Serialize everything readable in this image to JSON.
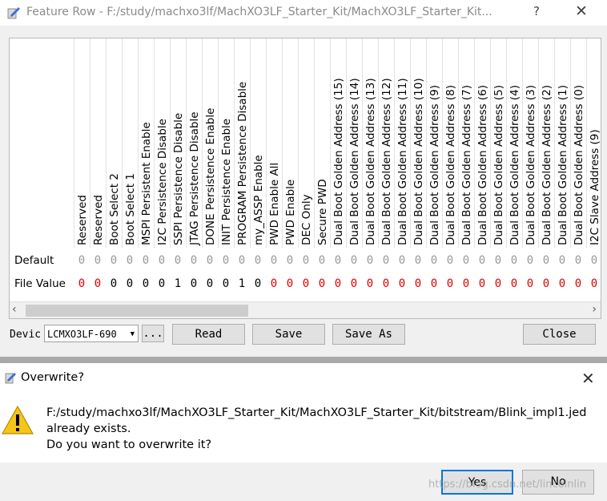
{
  "main_window": {
    "title": "Feature Row - F:/study/machxo3lf/MachXO3LF_Starter_Kit/MachXO3LF_Starter_Kit...",
    "help": "?",
    "close": "✕"
  },
  "grid": {
    "columns": [
      "Reserved",
      "Reserved",
      "Boot Select 2",
      "Boot Select 1",
      "MSPI Persistent Enable",
      "I2C Persistence Disable",
      "SSPI Persistence Disable",
      "JTAG Persistence Disable",
      "DONE Persistence Enable",
      "INIT Persistence Enable",
      "PROGRAM Persistence Disable",
      "my_ASSP Enable",
      "PWD Enable All",
      "PWD Enable",
      "DEC Only",
      "Secure PWD",
      "Dual Boot Golden Address (15)",
      "Dual Boot Golden Address (14)",
      "Dual Boot Golden Address (13)",
      "Dual Boot Golden Address (12)",
      "Dual Boot Golden Address (11)",
      "Dual Boot Golden Address (10)",
      "Dual Boot Golden Address (9)",
      "Dual Boot Golden Address (8)",
      "Dual Boot Golden Address (7)",
      "Dual Boot Golden Address (6)",
      "Dual Boot Golden Address (5)",
      "Dual Boot Golden Address (4)",
      "Dual Boot Golden Address (3)",
      "Dual Boot Golden Address (2)",
      "Dual Boot Golden Address (1)",
      "Dual Boot Golden Address (0)",
      "I2C Slave Address (9)"
    ],
    "row_labels": {
      "default": "Default",
      "file_value": "File Value"
    },
    "default_values": [
      "0",
      "0",
      "0",
      "0",
      "0",
      "0",
      "0",
      "0",
      "0",
      "0",
      "0",
      "0",
      "0",
      "0",
      "0",
      "0",
      "0",
      "0",
      "0",
      "0",
      "0",
      "0",
      "0",
      "0",
      "0",
      "0",
      "0",
      "0",
      "0",
      "0",
      "0",
      "0",
      "0"
    ],
    "file_values": [
      "0",
      "0",
      "0",
      "0",
      "0",
      "0",
      "1",
      "0",
      "0",
      "0",
      "1",
      "0",
      "0",
      "0",
      "0",
      "0",
      "0",
      "0",
      "0",
      "0",
      "0",
      "0",
      "0",
      "0",
      "0",
      "0",
      "0",
      "0",
      "0",
      "0",
      "0",
      "0",
      "0"
    ],
    "changed_flags": [
      1,
      1,
      0,
      0,
      0,
      0,
      0,
      0,
      0,
      0,
      0,
      0,
      1,
      1,
      1,
      1,
      1,
      1,
      1,
      1,
      1,
      1,
      1,
      1,
      1,
      1,
      1,
      1,
      1,
      1,
      1,
      1,
      1
    ],
    "scroll_left": "‹",
    "scroll_right": "›"
  },
  "toolbar": {
    "device_label": "Devic",
    "device_value": "LCMXO3LF-690",
    "browse_label": "...",
    "read_label": "Read",
    "save_label": "Save",
    "saveas_label": "Save As",
    "close_label": "Close"
  },
  "dialog": {
    "title": "Overwrite?",
    "close": "✕",
    "line1": "F:/study/machxo3lf/MachXO3LF_Starter_Kit/MachXO3LF_Starter_Kit/bitstream/Blink_impl1.jed",
    "line2": "already exists.",
    "line3": "Do you want to overwrite it?",
    "yes_label": "Yes",
    "no_label": "No",
    "watermark": "https://blog.csdn.net/lincolnlin"
  },
  "colors": {
    "changed": "#e00000",
    "unchanged": "#000000",
    "default_text": "#999999",
    "accent": "#0078d7"
  }
}
